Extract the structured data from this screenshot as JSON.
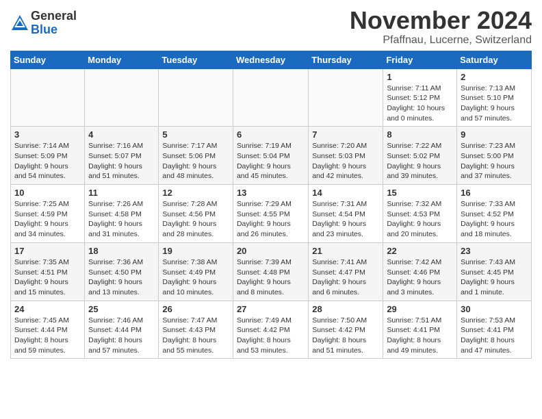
{
  "header": {
    "logo_general": "General",
    "logo_blue": "Blue",
    "month_title": "November 2024",
    "location": "Pfaffnau, Lucerne, Switzerland"
  },
  "days_of_week": [
    "Sunday",
    "Monday",
    "Tuesday",
    "Wednesday",
    "Thursday",
    "Friday",
    "Saturday"
  ],
  "weeks": [
    [
      {
        "day": "",
        "info": ""
      },
      {
        "day": "",
        "info": ""
      },
      {
        "day": "",
        "info": ""
      },
      {
        "day": "",
        "info": ""
      },
      {
        "day": "",
        "info": ""
      },
      {
        "day": "1",
        "info": "Sunrise: 7:11 AM\nSunset: 5:12 PM\nDaylight: 10 hours\nand 0 minutes."
      },
      {
        "day": "2",
        "info": "Sunrise: 7:13 AM\nSunset: 5:10 PM\nDaylight: 9 hours\nand 57 minutes."
      }
    ],
    [
      {
        "day": "3",
        "info": "Sunrise: 7:14 AM\nSunset: 5:09 PM\nDaylight: 9 hours\nand 54 minutes."
      },
      {
        "day": "4",
        "info": "Sunrise: 7:16 AM\nSunset: 5:07 PM\nDaylight: 9 hours\nand 51 minutes."
      },
      {
        "day": "5",
        "info": "Sunrise: 7:17 AM\nSunset: 5:06 PM\nDaylight: 9 hours\nand 48 minutes."
      },
      {
        "day": "6",
        "info": "Sunrise: 7:19 AM\nSunset: 5:04 PM\nDaylight: 9 hours\nand 45 minutes."
      },
      {
        "day": "7",
        "info": "Sunrise: 7:20 AM\nSunset: 5:03 PM\nDaylight: 9 hours\nand 42 minutes."
      },
      {
        "day": "8",
        "info": "Sunrise: 7:22 AM\nSunset: 5:02 PM\nDaylight: 9 hours\nand 39 minutes."
      },
      {
        "day": "9",
        "info": "Sunrise: 7:23 AM\nSunset: 5:00 PM\nDaylight: 9 hours\nand 37 minutes."
      }
    ],
    [
      {
        "day": "10",
        "info": "Sunrise: 7:25 AM\nSunset: 4:59 PM\nDaylight: 9 hours\nand 34 minutes."
      },
      {
        "day": "11",
        "info": "Sunrise: 7:26 AM\nSunset: 4:58 PM\nDaylight: 9 hours\nand 31 minutes."
      },
      {
        "day": "12",
        "info": "Sunrise: 7:28 AM\nSunset: 4:56 PM\nDaylight: 9 hours\nand 28 minutes."
      },
      {
        "day": "13",
        "info": "Sunrise: 7:29 AM\nSunset: 4:55 PM\nDaylight: 9 hours\nand 26 minutes."
      },
      {
        "day": "14",
        "info": "Sunrise: 7:31 AM\nSunset: 4:54 PM\nDaylight: 9 hours\nand 23 minutes."
      },
      {
        "day": "15",
        "info": "Sunrise: 7:32 AM\nSunset: 4:53 PM\nDaylight: 9 hours\nand 20 minutes."
      },
      {
        "day": "16",
        "info": "Sunrise: 7:33 AM\nSunset: 4:52 PM\nDaylight: 9 hours\nand 18 minutes."
      }
    ],
    [
      {
        "day": "17",
        "info": "Sunrise: 7:35 AM\nSunset: 4:51 PM\nDaylight: 9 hours\nand 15 minutes."
      },
      {
        "day": "18",
        "info": "Sunrise: 7:36 AM\nSunset: 4:50 PM\nDaylight: 9 hours\nand 13 minutes."
      },
      {
        "day": "19",
        "info": "Sunrise: 7:38 AM\nSunset: 4:49 PM\nDaylight: 9 hours\nand 10 minutes."
      },
      {
        "day": "20",
        "info": "Sunrise: 7:39 AM\nSunset: 4:48 PM\nDaylight: 9 hours\nand 8 minutes."
      },
      {
        "day": "21",
        "info": "Sunrise: 7:41 AM\nSunset: 4:47 PM\nDaylight: 9 hours\nand 6 minutes."
      },
      {
        "day": "22",
        "info": "Sunrise: 7:42 AM\nSunset: 4:46 PM\nDaylight: 9 hours\nand 3 minutes."
      },
      {
        "day": "23",
        "info": "Sunrise: 7:43 AM\nSunset: 4:45 PM\nDaylight: 9 hours\nand 1 minute."
      }
    ],
    [
      {
        "day": "24",
        "info": "Sunrise: 7:45 AM\nSunset: 4:44 PM\nDaylight: 8 hours\nand 59 minutes."
      },
      {
        "day": "25",
        "info": "Sunrise: 7:46 AM\nSunset: 4:44 PM\nDaylight: 8 hours\nand 57 minutes."
      },
      {
        "day": "26",
        "info": "Sunrise: 7:47 AM\nSunset: 4:43 PM\nDaylight: 8 hours\nand 55 minutes."
      },
      {
        "day": "27",
        "info": "Sunrise: 7:49 AM\nSunset: 4:42 PM\nDaylight: 8 hours\nand 53 minutes."
      },
      {
        "day": "28",
        "info": "Sunrise: 7:50 AM\nSunset: 4:42 PM\nDaylight: 8 hours\nand 51 minutes."
      },
      {
        "day": "29",
        "info": "Sunrise: 7:51 AM\nSunset: 4:41 PM\nDaylight: 8 hours\nand 49 minutes."
      },
      {
        "day": "30",
        "info": "Sunrise: 7:53 AM\nSunset: 4:41 PM\nDaylight: 8 hours\nand 47 minutes."
      }
    ]
  ]
}
